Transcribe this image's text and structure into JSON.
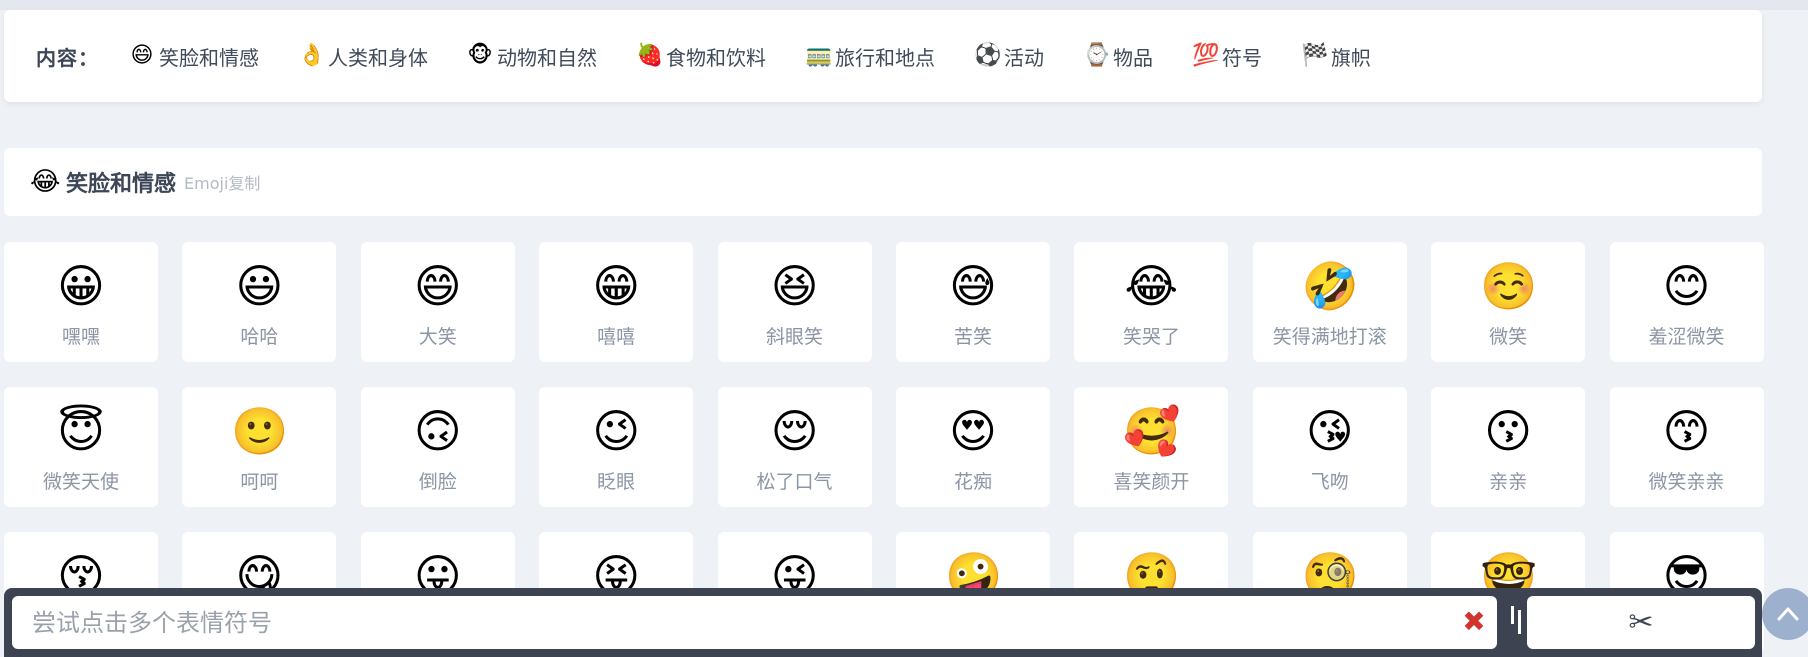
{
  "nav": {
    "label": "内容：",
    "items": [
      {
        "icon": "😄",
        "icon_name": "grinning-face-icon",
        "label": "笑脸和情感"
      },
      {
        "icon": "👌",
        "icon_name": "ok-hand-icon",
        "label": "人类和身体"
      },
      {
        "icon": "🐵",
        "icon_name": "monkey-face-icon",
        "label": "动物和自然"
      },
      {
        "icon": "🍓",
        "icon_name": "strawberry-icon",
        "label": "食物和饮料"
      },
      {
        "icon": "🚃",
        "icon_name": "railway-car-icon",
        "label": "旅行和地点"
      },
      {
        "icon": "⚽",
        "icon_name": "soccer-ball-icon",
        "label": "活动"
      },
      {
        "icon": "⌚",
        "icon_name": "watch-icon",
        "label": "物品"
      },
      {
        "icon": "💯",
        "icon_name": "hundred-points-icon",
        "label": "符号"
      },
      {
        "icon": "🏁",
        "icon_name": "checkered-flag-icon",
        "label": "旗帜"
      }
    ]
  },
  "section": {
    "icon": "😂",
    "icon_name": "face-with-tears-of-joy-icon",
    "title": "笑脸和情感",
    "subtitle": "Emoji复制"
  },
  "emojis": [
    {
      "char": "😀",
      "label": "嘿嘿"
    },
    {
      "char": "😃",
      "label": "哈哈"
    },
    {
      "char": "😄",
      "label": "大笑"
    },
    {
      "char": "😁",
      "label": "嘻嘻"
    },
    {
      "char": "😆",
      "label": "斜眼笑"
    },
    {
      "char": "😅",
      "label": "苦笑"
    },
    {
      "char": "😂",
      "label": "笑哭了"
    },
    {
      "char": "🤣",
      "label": "笑得满地打滚"
    },
    {
      "char": "☺️",
      "label": "微笑"
    },
    {
      "char": "😊",
      "label": "羞涩微笑"
    },
    {
      "char": "😇",
      "label": "微笑天使"
    },
    {
      "char": "🙂",
      "label": "呵呵"
    },
    {
      "char": "🙃",
      "label": "倒脸"
    },
    {
      "char": "😉",
      "label": "眨眼"
    },
    {
      "char": "😌",
      "label": "松了口气"
    },
    {
      "char": "😍",
      "label": "花痴"
    },
    {
      "char": "🥰",
      "label": "喜笑颜开"
    },
    {
      "char": "😘",
      "label": "飞吻"
    },
    {
      "char": "😗",
      "label": "亲亲"
    },
    {
      "char": "😙",
      "label": "微笑亲亲"
    },
    {
      "char": "😚",
      "label": ""
    },
    {
      "char": "😋",
      "label": ""
    },
    {
      "char": "😛",
      "label": ""
    },
    {
      "char": "😝",
      "label": ""
    },
    {
      "char": "😜",
      "label": ""
    },
    {
      "char": "🤪",
      "label": ""
    },
    {
      "char": "🤨",
      "label": ""
    },
    {
      "char": "🧐",
      "label": ""
    },
    {
      "char": "🤓",
      "label": ""
    },
    {
      "char": "😎",
      "label": ""
    }
  ],
  "bottom_bar": {
    "placeholder": "尝试点击多个表情符号",
    "clear_symbol": "✖",
    "copy_symbol": "✂"
  },
  "colors": {
    "accent": "#d0342c",
    "bar": "#3e4352",
    "to_top": "#9db0ce"
  }
}
